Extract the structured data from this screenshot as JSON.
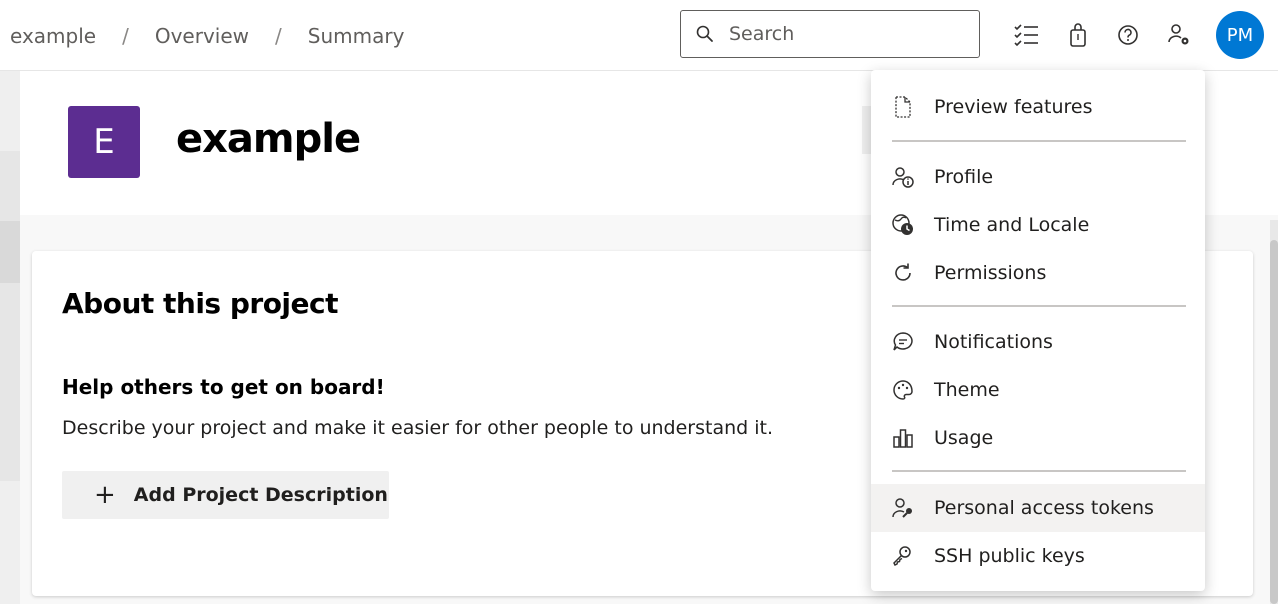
{
  "breadcrumb": {
    "items": [
      "example",
      "Overview",
      "Summary"
    ],
    "separator": "/"
  },
  "search": {
    "placeholder": "Search",
    "icon": "search-icon"
  },
  "top_icons": [
    "task-list-icon",
    "shopping-bag-icon",
    "help-icon",
    "user-settings-icon"
  ],
  "user": {
    "initials": "PM",
    "avatar_color": "#0078d4"
  },
  "project": {
    "initial": "E",
    "name": "example",
    "logo_color": "#5c2d91"
  },
  "about": {
    "title": "About this project",
    "subtitle": "Help others to get on board!",
    "description": "Describe your project and make it easier for other people to understand it.",
    "add_button_label": "Add Project Description"
  },
  "menu": {
    "items": [
      {
        "label": "Preview features",
        "icon": "document-icon"
      },
      {
        "label": "Profile",
        "icon": "profile-icon"
      },
      {
        "label": "Time and Locale",
        "icon": "globe-clock-icon"
      },
      {
        "label": "Permissions",
        "icon": "refresh-icon"
      },
      {
        "label": "Notifications",
        "icon": "chat-bubble-icon"
      },
      {
        "label": "Theme",
        "icon": "palette-icon"
      },
      {
        "label": "Usage",
        "icon": "bar-chart-icon"
      },
      {
        "label": "Personal access tokens",
        "icon": "person-key-icon"
      },
      {
        "label": "SSH public keys",
        "icon": "key-icon"
      }
    ],
    "highlighted": "Personal access tokens"
  }
}
